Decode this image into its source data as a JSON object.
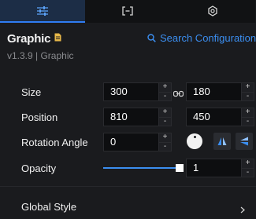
{
  "tabs": [
    {
      "name": "style",
      "icon": "sliders-icon",
      "active": true
    },
    {
      "name": "data",
      "icon": "bracket-box-icon",
      "active": false
    },
    {
      "name": "interaction",
      "icon": "refresh-dot-icon",
      "active": false
    }
  ],
  "header": {
    "title": "Graphic",
    "version": "v1.3.9 | Graphic",
    "search_label": "Search Configuration"
  },
  "size": {
    "label": "Size",
    "width": "300",
    "height": "180"
  },
  "position": {
    "label": "Position",
    "x": "810",
    "y": "450"
  },
  "rotation": {
    "label": "Rotation Angle",
    "value": "0"
  },
  "opacity": {
    "label": "Opacity",
    "value": "1",
    "slider_level": 1
  },
  "global_style": {
    "label": "Global Style"
  },
  "stepper": {
    "plus": "+",
    "minus": "-"
  },
  "colors": {
    "accent": "#3b8ef0",
    "panel_bg": "#1a1b1e",
    "input_bg": "#0d0e10",
    "tab_active": "#1c2d46"
  }
}
